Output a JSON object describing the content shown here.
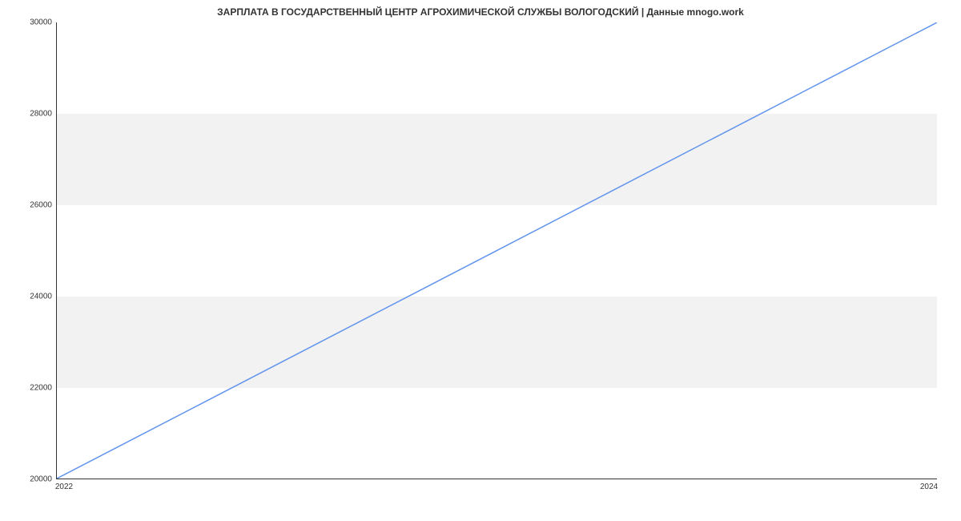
{
  "chart_data": {
    "type": "line",
    "title": "ЗАРПЛАТА В  ГОСУДАРСТВЕННЫЙ ЦЕНТР АГРОХИМИЧЕСКОЙ СЛУЖБЫ ВОЛОГОДСКИЙ | Данные mnogo.work",
    "x": [
      2022,
      2024
    ],
    "values": [
      20000,
      30000
    ],
    "xlabel": "",
    "ylabel": "",
    "x_ticks": [
      "2022",
      "2024"
    ],
    "y_ticks": [
      "20000",
      "22000",
      "24000",
      "26000",
      "28000",
      "30000"
    ],
    "xlim": [
      2022,
      2024
    ],
    "ylim": [
      20000,
      30000
    ],
    "line_color": "#6495ED"
  }
}
